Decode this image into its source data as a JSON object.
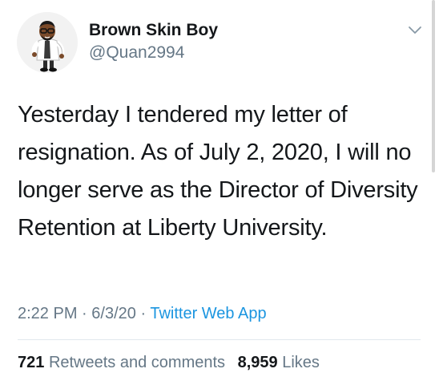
{
  "user": {
    "name": "Brown Skin Boy",
    "handle": "@Quan2994"
  },
  "tweet": {
    "text": "Yesterday I tendered my letter of resignation. As of July 2, 2020, I will no longer serve as the Director of Diversity Retention at Liberty University."
  },
  "meta": {
    "time": "2:22 PM",
    "separator": "·",
    "date": "6/3/20",
    "source": "Twitter Web App"
  },
  "stats": {
    "retweets_count": "721",
    "retweets_label": "Retweets and comments",
    "likes_count": "8,959",
    "likes_label": "Likes"
  },
  "icons": {
    "caret": "chevron-down-icon",
    "avatar": "avatar-memoji"
  },
  "colors": {
    "text": "#14171a",
    "secondary": "#657786",
    "link": "#1b95e0",
    "divider": "#e1e8ed"
  }
}
